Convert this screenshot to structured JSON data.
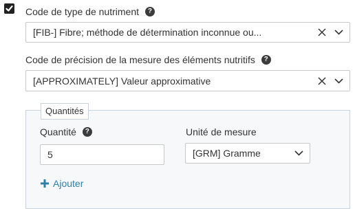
{
  "nutrient_type": {
    "checked": true,
    "label": "Code de type de nutriment",
    "help": "?",
    "value": "[FIB-] Fibre; méthode de détermination inconnue ou..."
  },
  "precision": {
    "label": "Code de précision de la mesure des éléments nutritifs",
    "help": "?",
    "value": "[APPROXIMATELY] Valeur approximative"
  },
  "quantities": {
    "legend": "Quantités",
    "quantity_label": "Quantité",
    "quantity_help": "?",
    "quantity_value": "5",
    "unit_label": "Unité de mesure",
    "unit_value": "[GRM] Gramme",
    "add_label": "Ajouter"
  },
  "colors": {
    "link": "#2f7fa6",
    "panel_bg": "#f6f8fa",
    "panel_border": "#c9d3dd"
  },
  "icons": {
    "check": "check-icon",
    "clear": "close-icon",
    "dropdown": "chevron-down-icon",
    "add": "plus-icon",
    "help": "help-icon"
  }
}
